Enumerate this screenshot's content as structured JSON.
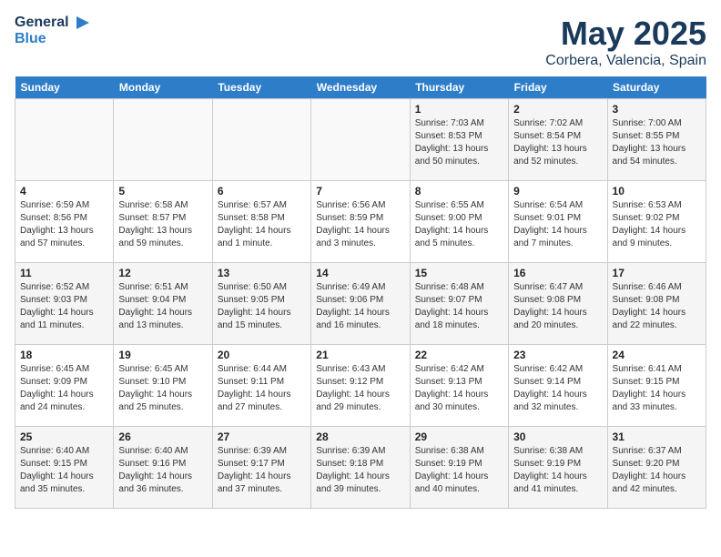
{
  "header": {
    "logo_line1": "General",
    "logo_line2": "Blue",
    "month": "May 2025",
    "location": "Corbera, Valencia, Spain"
  },
  "weekdays": [
    "Sunday",
    "Monday",
    "Tuesday",
    "Wednesday",
    "Thursday",
    "Friday",
    "Saturday"
  ],
  "weeks": [
    [
      {
        "day": "",
        "info": ""
      },
      {
        "day": "",
        "info": ""
      },
      {
        "day": "",
        "info": ""
      },
      {
        "day": "",
        "info": ""
      },
      {
        "day": "1",
        "info": "Sunrise: 7:03 AM\nSunset: 8:53 PM\nDaylight: 13 hours\nand 50 minutes."
      },
      {
        "day": "2",
        "info": "Sunrise: 7:02 AM\nSunset: 8:54 PM\nDaylight: 13 hours\nand 52 minutes."
      },
      {
        "day": "3",
        "info": "Sunrise: 7:00 AM\nSunset: 8:55 PM\nDaylight: 13 hours\nand 54 minutes."
      }
    ],
    [
      {
        "day": "4",
        "info": "Sunrise: 6:59 AM\nSunset: 8:56 PM\nDaylight: 13 hours\nand 57 minutes."
      },
      {
        "day": "5",
        "info": "Sunrise: 6:58 AM\nSunset: 8:57 PM\nDaylight: 13 hours\nand 59 minutes."
      },
      {
        "day": "6",
        "info": "Sunrise: 6:57 AM\nSunset: 8:58 PM\nDaylight: 14 hours\nand 1 minute."
      },
      {
        "day": "7",
        "info": "Sunrise: 6:56 AM\nSunset: 8:59 PM\nDaylight: 14 hours\nand 3 minutes."
      },
      {
        "day": "8",
        "info": "Sunrise: 6:55 AM\nSunset: 9:00 PM\nDaylight: 14 hours\nand 5 minutes."
      },
      {
        "day": "9",
        "info": "Sunrise: 6:54 AM\nSunset: 9:01 PM\nDaylight: 14 hours\nand 7 minutes."
      },
      {
        "day": "10",
        "info": "Sunrise: 6:53 AM\nSunset: 9:02 PM\nDaylight: 14 hours\nand 9 minutes."
      }
    ],
    [
      {
        "day": "11",
        "info": "Sunrise: 6:52 AM\nSunset: 9:03 PM\nDaylight: 14 hours\nand 11 minutes."
      },
      {
        "day": "12",
        "info": "Sunrise: 6:51 AM\nSunset: 9:04 PM\nDaylight: 14 hours\nand 13 minutes."
      },
      {
        "day": "13",
        "info": "Sunrise: 6:50 AM\nSunset: 9:05 PM\nDaylight: 14 hours\nand 15 minutes."
      },
      {
        "day": "14",
        "info": "Sunrise: 6:49 AM\nSunset: 9:06 PM\nDaylight: 14 hours\nand 16 minutes."
      },
      {
        "day": "15",
        "info": "Sunrise: 6:48 AM\nSunset: 9:07 PM\nDaylight: 14 hours\nand 18 minutes."
      },
      {
        "day": "16",
        "info": "Sunrise: 6:47 AM\nSunset: 9:08 PM\nDaylight: 14 hours\nand 20 minutes."
      },
      {
        "day": "17",
        "info": "Sunrise: 6:46 AM\nSunset: 9:08 PM\nDaylight: 14 hours\nand 22 minutes."
      }
    ],
    [
      {
        "day": "18",
        "info": "Sunrise: 6:45 AM\nSunset: 9:09 PM\nDaylight: 14 hours\nand 24 minutes."
      },
      {
        "day": "19",
        "info": "Sunrise: 6:45 AM\nSunset: 9:10 PM\nDaylight: 14 hours\nand 25 minutes."
      },
      {
        "day": "20",
        "info": "Sunrise: 6:44 AM\nSunset: 9:11 PM\nDaylight: 14 hours\nand 27 minutes."
      },
      {
        "day": "21",
        "info": "Sunrise: 6:43 AM\nSunset: 9:12 PM\nDaylight: 14 hours\nand 29 minutes."
      },
      {
        "day": "22",
        "info": "Sunrise: 6:42 AM\nSunset: 9:13 PM\nDaylight: 14 hours\nand 30 minutes."
      },
      {
        "day": "23",
        "info": "Sunrise: 6:42 AM\nSunset: 9:14 PM\nDaylight: 14 hours\nand 32 minutes."
      },
      {
        "day": "24",
        "info": "Sunrise: 6:41 AM\nSunset: 9:15 PM\nDaylight: 14 hours\nand 33 minutes."
      }
    ],
    [
      {
        "day": "25",
        "info": "Sunrise: 6:40 AM\nSunset: 9:15 PM\nDaylight: 14 hours\nand 35 minutes."
      },
      {
        "day": "26",
        "info": "Sunrise: 6:40 AM\nSunset: 9:16 PM\nDaylight: 14 hours\nand 36 minutes."
      },
      {
        "day": "27",
        "info": "Sunrise: 6:39 AM\nSunset: 9:17 PM\nDaylight: 14 hours\nand 37 minutes."
      },
      {
        "day": "28",
        "info": "Sunrise: 6:39 AM\nSunset: 9:18 PM\nDaylight: 14 hours\nand 39 minutes."
      },
      {
        "day": "29",
        "info": "Sunrise: 6:38 AM\nSunset: 9:19 PM\nDaylight: 14 hours\nand 40 minutes."
      },
      {
        "day": "30",
        "info": "Sunrise: 6:38 AM\nSunset: 9:19 PM\nDaylight: 14 hours\nand 41 minutes."
      },
      {
        "day": "31",
        "info": "Sunrise: 6:37 AM\nSunset: 9:20 PM\nDaylight: 14 hours\nand 42 minutes."
      }
    ]
  ]
}
